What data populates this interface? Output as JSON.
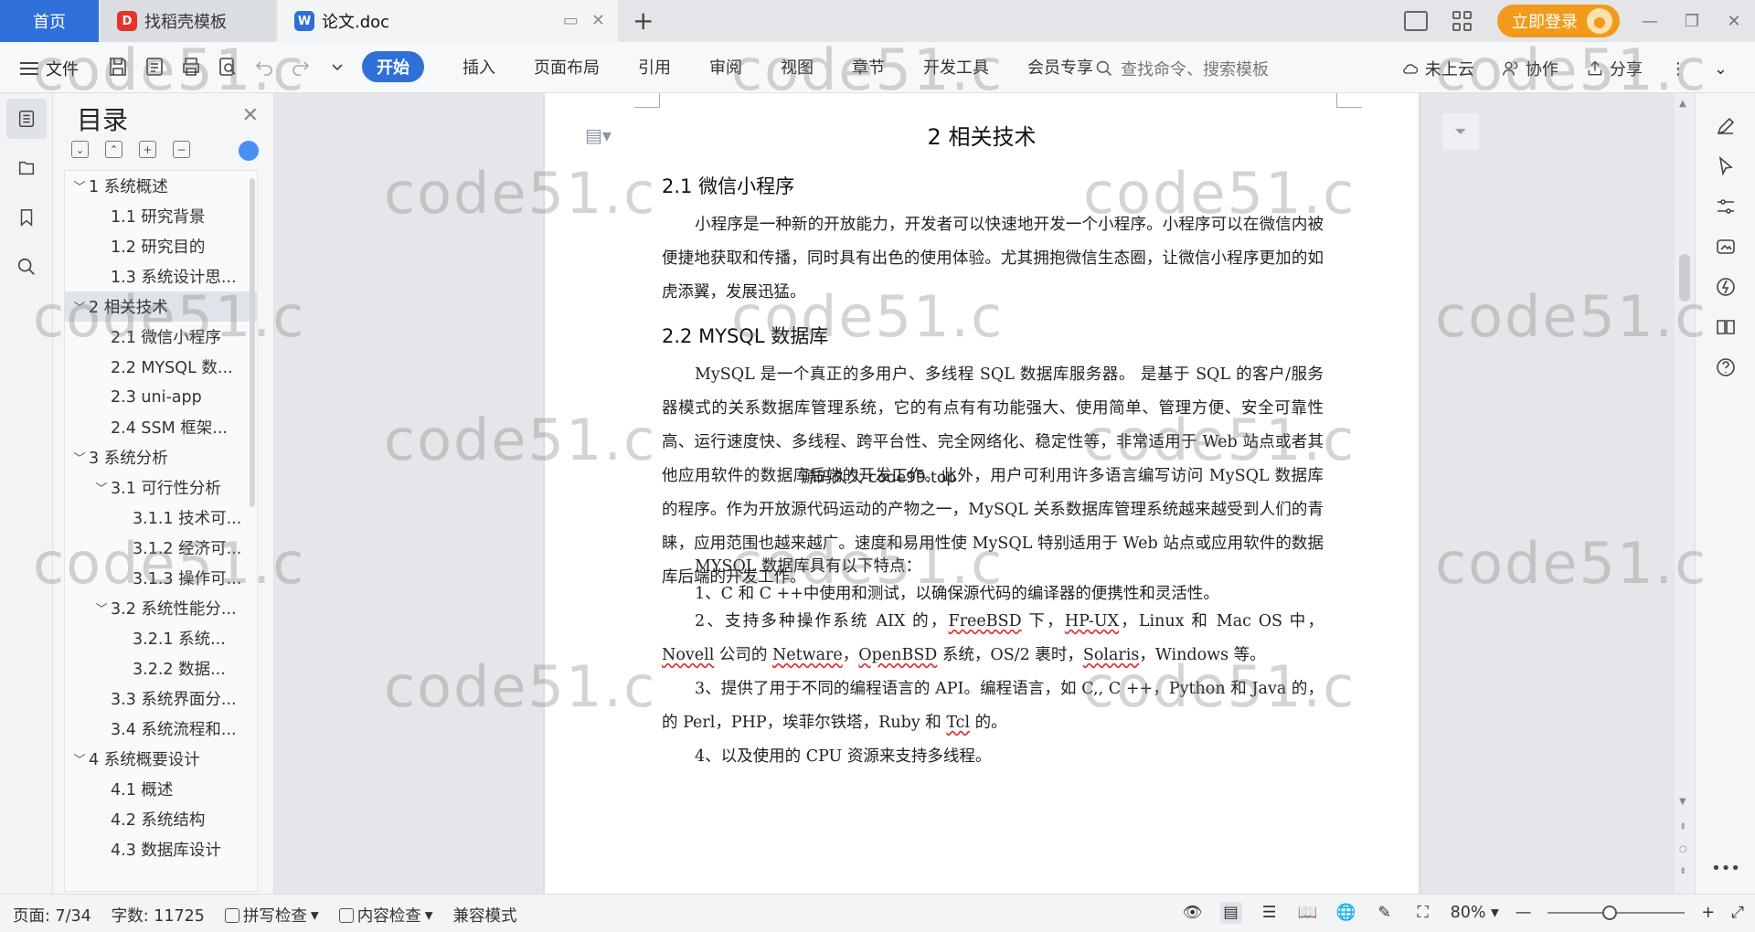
{
  "tabs": {
    "home": "首页",
    "template": "找稻壳模板",
    "doc": "论文.doc",
    "login": "立即登录"
  },
  "ribbon": {
    "file": "文件",
    "menu": [
      "开始",
      "插入",
      "页面布局",
      "引用",
      "审阅",
      "视图",
      "章节",
      "开发工具",
      "会员专享"
    ],
    "active_menu": "开始",
    "search_placeholder": "查找命令、搜索模板",
    "cloud": "未上云",
    "collab": "协作",
    "share": "分享"
  },
  "toc": {
    "title": "目录",
    "items": [
      {
        "label": "1 系统概述",
        "level": 1,
        "expanded": true
      },
      {
        "label": "1.1  研究背景",
        "level": 2
      },
      {
        "label": "1.2 研究目的",
        "level": 2
      },
      {
        "label": "1.3 系统设计思...",
        "level": 2
      },
      {
        "label": "2 相关技术",
        "level": 1,
        "expanded": true,
        "selected": true
      },
      {
        "label": "2.1 微信小程序",
        "level": 2
      },
      {
        "label": "2.2 MYSQL 数...",
        "level": 2
      },
      {
        "label": "2.3 uni-app",
        "level": 2
      },
      {
        "label": "2.4 SSM 框架...",
        "level": 2
      },
      {
        "label": "3 系统分析",
        "level": 1,
        "expanded": true
      },
      {
        "label": "3.1 可行性分析",
        "level": 2,
        "expanded": true
      },
      {
        "label": "3.1.1 技术可...",
        "level": 3
      },
      {
        "label": "3.1.2 经济可...",
        "level": 3
      },
      {
        "label": "3.1.3 操作可...",
        "level": 3
      },
      {
        "label": "3.2 系统性能分...",
        "level": 2,
        "expanded": true
      },
      {
        "label": "3.2.1  系统...",
        "level": 3
      },
      {
        "label": "3.2.2  数据...",
        "level": 3
      },
      {
        "label": "3.3 系统界面分...",
        "level": 2
      },
      {
        "label": "3.4 系统流程和...",
        "level": 2
      },
      {
        "label": "4 系统概要设计",
        "level": 1,
        "expanded": true
      },
      {
        "label": "4.1 概述",
        "level": 2
      },
      {
        "label": "4.2 系统结构",
        "level": 2
      },
      {
        "label": "4.3 数据库设计",
        "level": 2
      }
    ]
  },
  "document": {
    "chapter_title": "2 相关技术",
    "section1_title": "2.1 微信小程序",
    "section1_para": "小程序是一种新的开放能力，开发者可以快速地开发一个小程序。小程序可以在微信内被便捷地获取和传播，同时具有出色的使用体验。尤其拥抱微信生态圈，让微信小程序更加的如虎添翼，发展迅猛。",
    "section2_title": "2.2 MYSQL 数据库",
    "section2_para": "MySQL 是一个真正的多用户、多线程 SQL 数据库服务器。 是基于 SQL 的客户/服务器模式的关系数据库管理系统，它的有点有有功能强大、使用简单、管理方便、安全可靠性高、运行速度快、多线程、跨平台性、完全网络化、稳定性等，非常适用于 Web 站点或者其他应用软件的数据库后端的开发工作。此外，用户可利用许多语言编写访问 MySQL 数据库的程序。作为开放源代码运动的产物之一，MySQL 关系数据库管理系统越来越受到人们的青睐，应用范围也越来越广。速度和易用性使 MySQL 特别适用于 Web 站点或应用软件的数据库后端的开发工作。",
    "features_intro": "MYSQL 数据库具有以下特点：",
    "feature1": "1、C 和 C ++中使用和测试，以确保源代码的编译器的便携性和灵活性。",
    "feature2_pre": "2、支持多种操作系统 AIX 的，",
    "feature2_w1": "FreeBSD",
    "feature2_m1": " 下，",
    "feature2_w2": "HP-UX",
    "feature2_m2": "，Linux 和 Mac OS 中，",
    "feature2_w3": "Novell",
    "feature2_m3": " 公司的 ",
    "feature2_w4": "Netware",
    "feature2_m4": "，",
    "feature2_w5": "OpenBSD",
    "feature2_m5": " 系统，OS/2 裹时，",
    "feature2_w6": "Solaris",
    "feature2_post": "，Windows 等。",
    "feature3_pre": "3、提供了用于不同的编程语言的 API。编程语言，如 C,, C ++，Python 和 Java 的，的 Perl，PHP，埃菲尔铁塔，Ruby 和 ",
    "feature3_w": "Tcl",
    "feature3_post": " 的。",
    "feature4": "4、以及使用的 CPU 资源来支持多线程。",
    "source_note": "源码久久-code99.top"
  },
  "statusbar": {
    "page": "页面: 7/34",
    "words": "字数: 11725",
    "spell": "拼写检查",
    "content_check": "内容检查",
    "compat": "兼容模式",
    "zoom": "80%",
    "zoom_level": 0.45
  },
  "watermark": "code51.c"
}
